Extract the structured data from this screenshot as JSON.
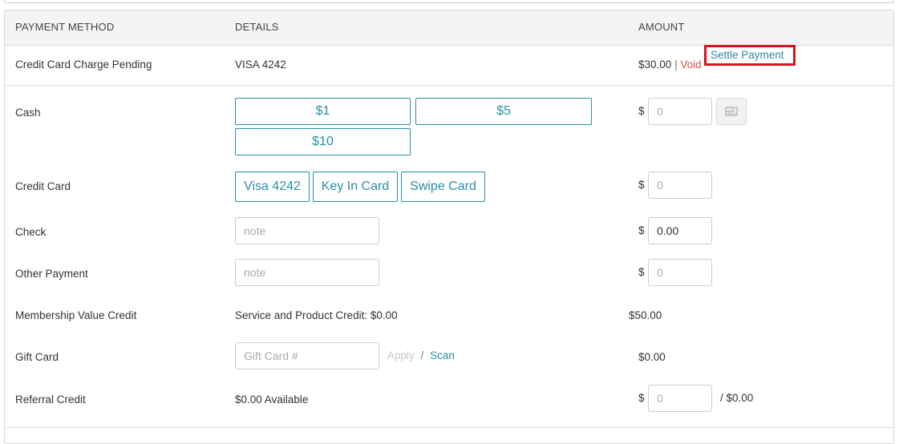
{
  "header": {
    "col_method": "PAYMENT METHOD",
    "col_details": "DETAILS",
    "col_amount": "AMOUNT"
  },
  "pending": {
    "method": "Credit Card Charge Pending",
    "details": "VISA 4242",
    "amount": "$30.00",
    "separator": "|",
    "void_label": "Void",
    "settle_label": "Settle Payment"
  },
  "cash": {
    "label": "Cash",
    "buttons": [
      "$1",
      "$5",
      "$10"
    ],
    "currency": "$",
    "placeholder": "0",
    "register_icon": "cash-register-icon"
  },
  "credit_card": {
    "label": "Credit Card",
    "buttons": [
      "Visa 4242",
      "Key In Card",
      "Swipe Card"
    ],
    "currency": "$",
    "placeholder": "0"
  },
  "check": {
    "label": "Check",
    "note_placeholder": "note",
    "currency": "$",
    "value": "0.00"
  },
  "other": {
    "label": "Other Payment",
    "note_placeholder": "note",
    "currency": "$",
    "placeholder": "0"
  },
  "membership": {
    "label": "Membership Value Credit",
    "details": "Service and Product Credit: $0.00",
    "amount": "$50.00"
  },
  "gift_card": {
    "label": "Gift Card",
    "placeholder": "Gift Card #",
    "apply_label": "Apply",
    "slash": "/",
    "scan_label": "Scan",
    "amount": "$0.00"
  },
  "referral": {
    "label": "Referral Credit",
    "details": "$0.00 Available",
    "currency": "$",
    "placeholder": "0",
    "max": "/ $0.00"
  },
  "colors": {
    "accent": "#2a8fa6",
    "void": "#d9534f",
    "highlight": "#d9141e"
  }
}
